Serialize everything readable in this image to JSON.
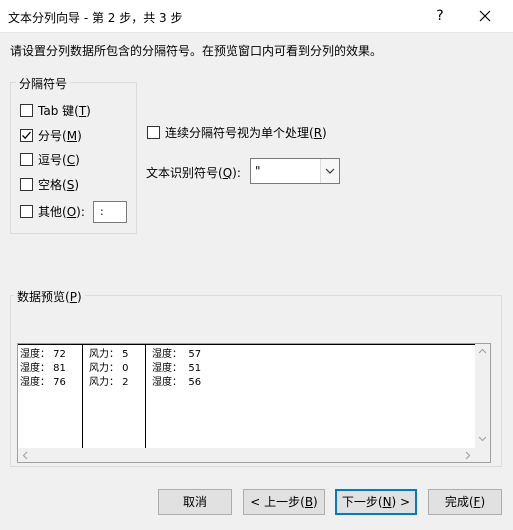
{
  "window": {
    "title": "文本分列向导 - 第 2 步，共 3 步",
    "help": "?"
  },
  "instruction": "请设置分列数据所包含的分隔符号。在预览窗口内可看到分列的效果。",
  "delimiters": {
    "legend": "分隔符号",
    "tab": {
      "label": "Tab 键",
      "key": "T",
      "checked": false
    },
    "semicolon": {
      "label": "分号",
      "key": "M",
      "checked": true
    },
    "comma": {
      "label": "逗号",
      "key": "C",
      "checked": false
    },
    "space": {
      "label": "空格",
      "key": "S",
      "checked": false
    },
    "other": {
      "label": "其他",
      "key": "O",
      "checked": false,
      "value": ":"
    }
  },
  "consecutive": {
    "label": "连续分隔符号视为单个处理",
    "key": "R",
    "checked": false
  },
  "text_qualifier": {
    "label": "文本识别符号",
    "key": "Q",
    "value": "\""
  },
  "preview": {
    "legend": "数据预览",
    "key": "P",
    "rows": [
      [
        "湿度： 72",
        "风力： 5",
        "湿度：  57"
      ],
      [
        "湿度： 81",
        "风力： 0",
        "湿度：  51"
      ],
      [
        "湿度： 76",
        "风力： 2",
        "湿度：  56"
      ]
    ]
  },
  "buttons": {
    "cancel": "取消",
    "back_prefix": "< 上一步(",
    "back_key": "B",
    "back_suffix": ")",
    "next_prefix": "下一步(",
    "next_key": "N",
    "next_suffix": ") >",
    "finish_prefix": "完成(",
    "finish_key": "F",
    "finish_suffix": ")"
  },
  "colors": {
    "accent": "#0078d7",
    "background": "#f0f0f0"
  }
}
